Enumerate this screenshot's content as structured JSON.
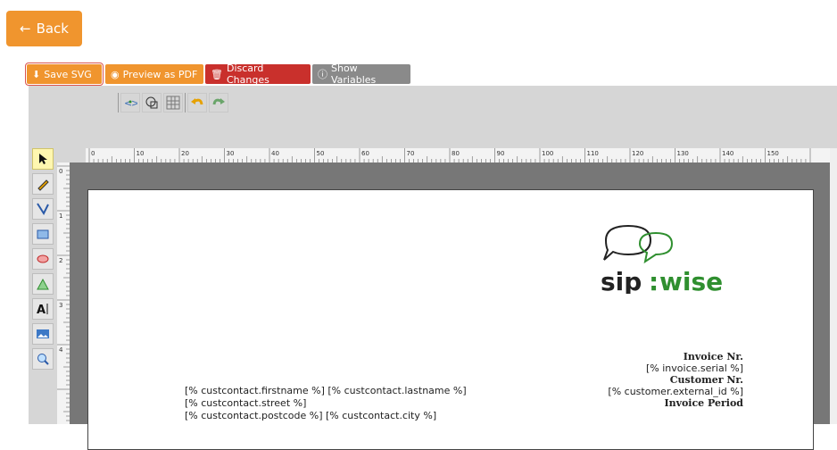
{
  "back_button": {
    "label": "Back"
  },
  "actions": {
    "save_svg": "Save SVG",
    "preview_pdf": "Preview as PDF",
    "discard": "Discard Changes",
    "show_vars": "Show Variables"
  },
  "ruler": {
    "marks": [
      "0",
      "10",
      "20",
      "30",
      "40",
      "50",
      "60",
      "70",
      "80",
      "90",
      "100",
      "110",
      "120",
      "130",
      "140",
      "150"
    ],
    "vertical": [
      "0",
      "1",
      "2",
      "3",
      "4"
    ]
  },
  "paper": {
    "address_lines": [
      "[% custcontact.firstname %] [% custcontact.lastname %]",
      "[% custcontact.street %]",
      "[% custcontact.postcode %] [% custcontact.city %]"
    ],
    "invoice_nr_label": "Invoice Nr.",
    "invoice_serial": "[% invoice.serial %]",
    "customer_nr_label": "Customer Nr.",
    "customer_external_id": "[% customer.external_id %]",
    "invoice_period_label": "Invoice Period"
  },
  "colors": {
    "orange": "#f0952e",
    "red": "#c9302c",
    "gray": "#8a8a8a",
    "logo_green": "#2f8f2f",
    "logo_dark": "#222222"
  }
}
